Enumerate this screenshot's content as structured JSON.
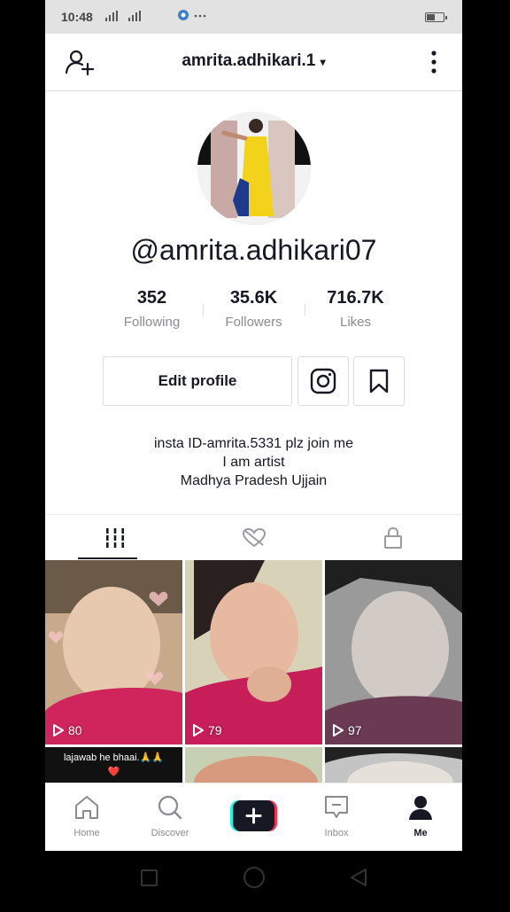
{
  "status_bar": {
    "time": "10:48",
    "signal": "°⁩ıl .ıl",
    "extra": "···"
  },
  "header": {
    "username": "amrita.adhikari.1",
    "caret": "▾",
    "icons": [
      "add-user-icon",
      "more-vertical-icon"
    ]
  },
  "profile": {
    "handle": "@amrita.adhikari07",
    "stats": [
      {
        "value": "352",
        "label": "Following"
      },
      {
        "value": "35.6K",
        "label": "Followers"
      },
      {
        "value": "716.7K",
        "label": "Likes"
      }
    ],
    "edit_label": "Edit profile",
    "bio": [
      "insta ID-amrita.5331 plz join me",
      "I am artist",
      "Madhya Pradesh Ujjain"
    ]
  },
  "tabs": [
    "videos-grid-icon",
    "liked-hidden-icon",
    "private-lock-icon"
  ],
  "grid": [
    {
      "views": "80"
    },
    {
      "views": "79"
    },
    {
      "views": "97"
    },
    {
      "caption": "lajawab he bhaai.🙏🙏❤️"
    }
  ],
  "navbar": [
    {
      "label": "Home"
    },
    {
      "label": "Discover"
    },
    {
      "label": ""
    },
    {
      "label": "Inbox"
    },
    {
      "label": "Me"
    }
  ],
  "colors": {
    "accent_cyan": "#25f4ee",
    "accent_red": "#fe2c55",
    "text": "#161823",
    "muted": "#8a8b91"
  }
}
